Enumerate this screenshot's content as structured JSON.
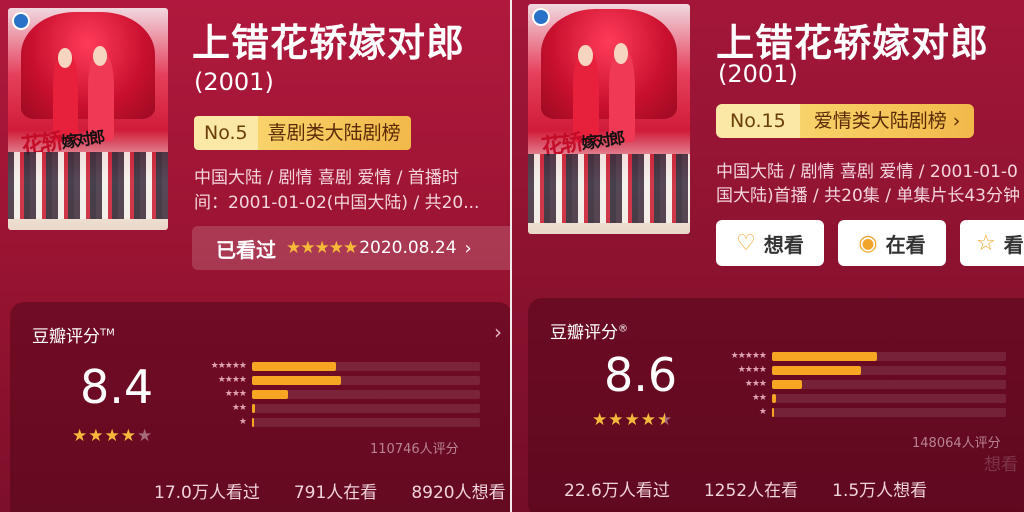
{
  "left": {
    "title": "上错花轿嫁对郎",
    "year": "(2001)",
    "rank_no": "No.5",
    "rank_cat": "喜剧类大陆剧榜",
    "meta_line1": "中国大陆 / 剧情 喜剧 爱情 / 首播时",
    "meta_line2": "间：2001-01-02(中国大陆) / 共20...",
    "watched": {
      "label": "已看过",
      "stars": "★★★★★",
      "date": "2020.08.24",
      "chevron": "›"
    },
    "rating": {
      "header": "豆瓣评分",
      "mark": "TM",
      "score": "8.4",
      "stars_value": 4,
      "count": "110746人评分",
      "distribution": [
        {
          "label": "★★★★★",
          "percent": 37
        },
        {
          "label": "★★★★",
          "percent": 39
        },
        {
          "label": "★★★",
          "percent": 16
        },
        {
          "label": "★★",
          "percent": 1.5
        },
        {
          "label": "★",
          "percent": 0.5
        }
      ],
      "stats": [
        "17.0万人看过",
        "791人在看",
        "8920人想看"
      ]
    }
  },
  "right": {
    "title": "上错花轿嫁对郎",
    "year": "(2001)",
    "rank_no": "No.15",
    "rank_cat": "爱情类大陆剧榜",
    "rank_chevron": "›",
    "meta_line1": "中国大陆 / 剧情 喜剧 爱情 / 2001-01-0",
    "meta_line2": "国大陆)首播 / 共20集 / 单集片长43分钟",
    "buttons": [
      {
        "label": "想看",
        "icon": "heart-plus-icon",
        "glyph": "♡"
      },
      {
        "label": "在看",
        "icon": "target-icon",
        "glyph": "◉"
      },
      {
        "label": "看",
        "icon": "star-outline-icon",
        "glyph": "☆"
      }
    ],
    "rating": {
      "header": "豆瓣评分",
      "mark": "®",
      "score": "8.6",
      "stars_value": 4.5,
      "count": "148064人评分",
      "distribution": [
        {
          "label": "★★★★★",
          "percent": 45
        },
        {
          "label": "★★★★",
          "percent": 38
        },
        {
          "label": "★★★",
          "percent": 13
        },
        {
          "label": "★★",
          "percent": 1.5
        },
        {
          "label": "★",
          "percent": 0.5
        }
      ],
      "stats": [
        "22.6万人看过",
        "1252人在看",
        "1.5万人想看"
      ],
      "ghost_text": "想看"
    }
  },
  "poster_text": {
    "calligraphy_a": "花轿",
    "calligraphy_b": "嫁对郎"
  },
  "colors": {
    "accent_gold": "#f6b93a",
    "bar_orange": "#f6a623",
    "bg_red": "#9c1433"
  }
}
